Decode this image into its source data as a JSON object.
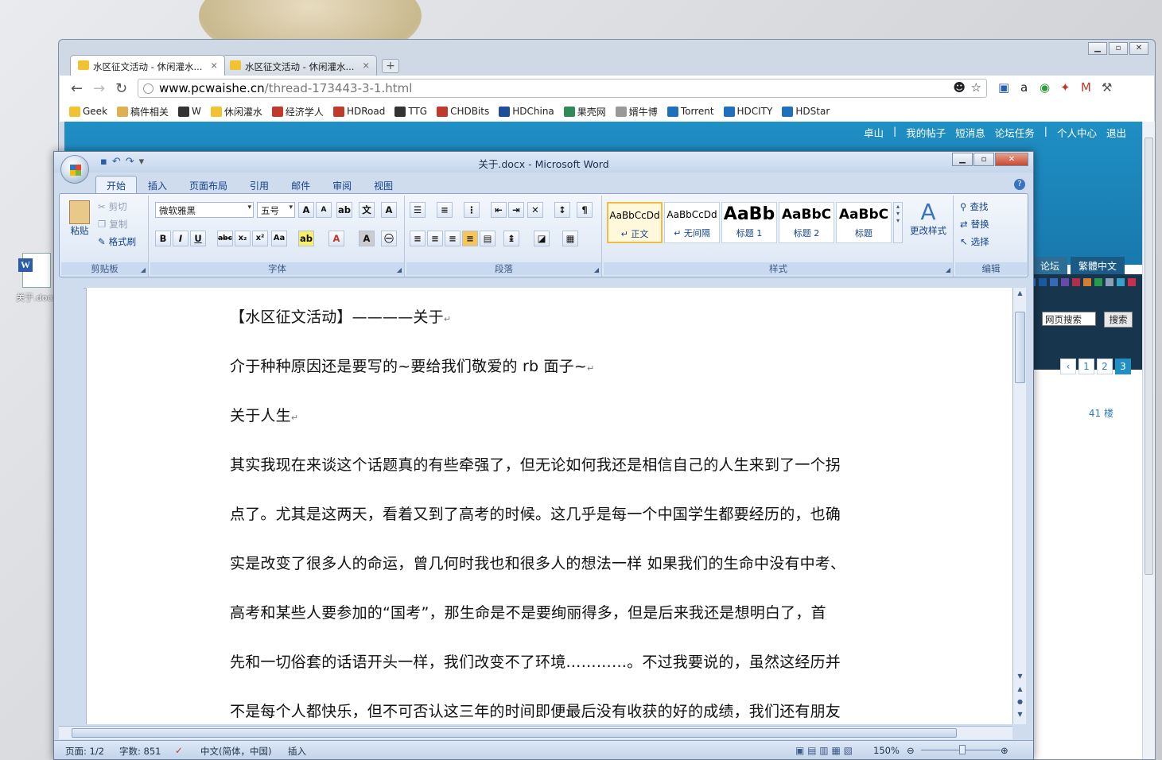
{
  "desktop": {
    "icon_label": "关于.docx"
  },
  "chrome": {
    "tabs": [
      {
        "title": "水区征文活动 - 休闲灌水..."
      },
      {
        "title": "水区征文活动 - 休闲灌水..."
      }
    ],
    "url_host": "www.pcwaishe.cn",
    "url_path": "/thread-173443-3-1.html",
    "bookmarks": [
      "Geek",
      "稿件相关",
      "W",
      "休闲灌水",
      "经济学人",
      "HDRoad",
      "TTG",
      "CHDBits",
      "HDChina",
      "果壳网",
      "婿牛博",
      "Torrent",
      "HDCITY",
      "HDStar"
    ],
    "bookmark_icon_colors": [
      "#f2c230",
      "#e0b050",
      "#333333",
      "#f2c230",
      "#c0392b",
      "#c0392b",
      "#333333",
      "#c0392b",
      "#1f4e9c",
      "#2e8b57",
      "#999999",
      "#1f6fbf",
      "#1f6fbf",
      "#1f6fbf"
    ]
  },
  "site": {
    "top_links": [
      "卓山",
      "|",
      "我的帖子",
      "短消息",
      "论坛任务",
      "|",
      "个人中心",
      "退出"
    ],
    "tabs": [
      "论坛",
      "繁體中文"
    ],
    "search_select": "网页搜索",
    "search_button": "搜索",
    "pages": [
      "‹",
      "1",
      "2",
      "3"
    ],
    "floor": "41 楼",
    "swatch_colors": [
      "#2b7bd0",
      "#1a5aa0",
      "#3a68b8",
      "#6a4aa8",
      "#b0304a",
      "#d08030",
      "#2a9a4a",
      "#8aa0b8",
      "#3aa0c8",
      "#c83050"
    ]
  },
  "word": {
    "title": "关于.docx - Microsoft Word",
    "ribbon_tabs": [
      "开始",
      "插入",
      "页面布局",
      "引用",
      "邮件",
      "审阅",
      "视图"
    ],
    "clipboard": {
      "paste": "粘贴",
      "cut": "剪切",
      "copy": "复制",
      "format_painter": "格式刷",
      "label": "剪贴板"
    },
    "font": {
      "name": "微软雅黑",
      "size": "五号",
      "label": "字体"
    },
    "paragraph": {
      "label": "段落"
    },
    "styles": {
      "items": [
        {
          "preview": "AaBbCcDd",
          "name": "↵ 正文"
        },
        {
          "preview": "AaBbCcDd",
          "name": "↵ 无间隔"
        },
        {
          "preview": "AaBb",
          "name": "标题 1"
        },
        {
          "preview": "AaBbC",
          "name": "标题 2"
        },
        {
          "preview": "AaBbC",
          "name": "标题"
        }
      ],
      "change": "更改样式",
      "label": "样式"
    },
    "editing": {
      "find": "查找",
      "replace": "替换",
      "select": "选择",
      "label": "编辑"
    },
    "document": [
      "【水区征文活动】————关于",
      "介于种种原因还是要写的~要给我们敬爱的 rb 面子~",
      "关于人生",
      "其实我现在来谈这个话题真的有些牵强了，但无论如何我还是相信自己的人生来到了一个拐",
      "点了。尤其是这两天，看着又到了高考的时候。这几乎是每一个中国学生都要经历的，也确",
      "实是改变了很多人的命运，曾几何时我也和很多人的想法一样 如果我们的生命中没有中考、",
      "高考和某些人要参加的“国考”，那生命是不是要绚丽得多，但是后来我还是想明白了，首",
      "先和一切俗套的话语开头一样，我们改变不了环境…………。不过我要说的，虽然这经历并",
      "不是每个人都快乐，但不可否认这三年的时间即便最后没有收获的好的成绩，我们还有朋友"
    ],
    "paragraph_mark": "↵",
    "status": {
      "page": "页面: 1/2",
      "words": "字数: 851",
      "lang": "中文(简体，中国)",
      "mode": "插入",
      "zoom": "150%"
    }
  }
}
